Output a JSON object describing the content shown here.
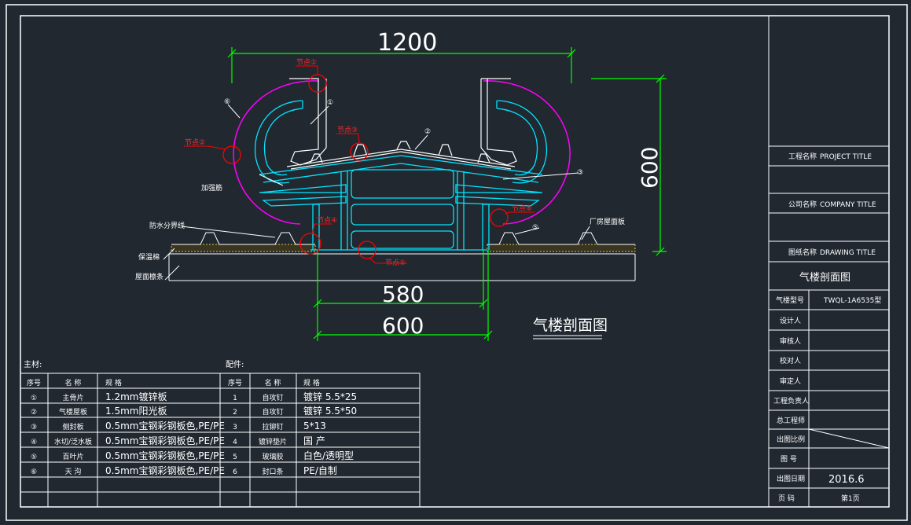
{
  "colors": {
    "background": "#212830",
    "frame": "#ffffff",
    "cyan": "#00e5ff",
    "green": "#00ff00",
    "magenta": "#ff00ff",
    "red": "#ff0000",
    "yellow": "#d9c74a"
  },
  "drawing": {
    "title": "气楼剖面图",
    "dims": {
      "top_width": "1200",
      "height": "600",
      "inner_width": "580",
      "outer_width": "600"
    },
    "nodes": {
      "n1": "节点①",
      "n2": "节点②",
      "n3": "节点③",
      "n4": "节点④",
      "n5": "节点⑤",
      "n6": "节点⑥"
    },
    "callouts": {
      "c1": "①",
      "c2": "②",
      "c3": "③",
      "c4": "④",
      "c5": "⑤",
      "c6": "⑥"
    },
    "labels": {
      "stiffener": "加强筋",
      "water_line": "防水分界线",
      "insulation": "保温棉",
      "roof_panel": "屋面檩条",
      "factory_panel": "厂房屋面板"
    }
  },
  "main_table": {
    "caption": "主材:",
    "headers": [
      "序号",
      "名  称",
      "规  格"
    ],
    "rows": [
      {
        "no": "①",
        "name": "主骨片",
        "spec": "1.2mm镀锌板"
      },
      {
        "no": "②",
        "name": "气楼屋板",
        "spec": "1.5mm阳光板"
      },
      {
        "no": "③",
        "name": "侧封板",
        "spec": "0.5mm宝钢彩钢板色,PE/PE"
      },
      {
        "no": "④",
        "name": "水切/泛水板",
        "spec": "0.5mm宝钢彩钢板色,PE/PE"
      },
      {
        "no": "⑤",
        "name": "百叶片",
        "spec": "0.5mm宝钢彩钢板色,PE/PE"
      },
      {
        "no": "⑥",
        "name": "天 沟",
        "spec": "0.5mm宝钢彩钢板色,PE/PE"
      }
    ]
  },
  "parts_table": {
    "caption": "配件:",
    "headers": [
      "序号",
      "名  称",
      "规  格"
    ],
    "rows": [
      {
        "no": "1",
        "name": "自攻钉",
        "spec": "镀锌 5.5*25"
      },
      {
        "no": "2",
        "name": "自攻钉",
        "spec": "镀锌 5.5*50"
      },
      {
        "no": "3",
        "name": "拉铆钉",
        "spec": "5*13"
      },
      {
        "no": "4",
        "name": "镀锌垫片",
        "spec": "国 产"
      },
      {
        "no": "5",
        "name": "玻璃胶",
        "spec": "白色/透明型"
      },
      {
        "no": "6",
        "name": "封口条",
        "spec": "PE/自制"
      }
    ]
  },
  "title_block": {
    "project_label": "工程名称",
    "project_title": "PROJECT TITLE",
    "company_label": "公司名称",
    "company_title": "COMPANY TITLE",
    "drawing_label": "图纸名称",
    "drawing_title": "DRAWING TITLE",
    "drawing_name": "气楼剖面图",
    "model_label": "气楼型号",
    "model_value": "TWQL-1A6535型",
    "designer": "设计人",
    "reviewer": "审核人",
    "checker": "校对人",
    "approver": "审定人",
    "engineer": "工程负责人",
    "chief": "总工程师",
    "scale": "出图比例",
    "drawing_no": "图 号",
    "date_label": "出图日期",
    "date_value": "2016.6",
    "page_label": "页 码",
    "page_value": "第1页"
  }
}
